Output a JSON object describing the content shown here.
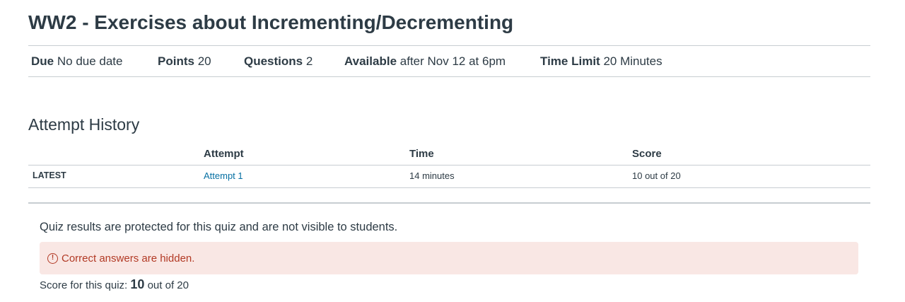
{
  "quiz": {
    "title": "WW2 - Exercises about Incrementing/Decrementing"
  },
  "details": {
    "due_label": "Due",
    "due_value": "No due date",
    "points_label": "Points",
    "points_value": "20",
    "questions_label": "Questions",
    "questions_value": "2",
    "available_label": "Available",
    "available_value": "after Nov 12 at 6pm",
    "time_limit_label": "Time Limit",
    "time_limit_value": "20 Minutes"
  },
  "history": {
    "title": "Attempt History",
    "columns": [
      "Attempt",
      "Time",
      "Score"
    ],
    "rows": [
      {
        "badge": "LATEST",
        "attempt": "Attempt 1",
        "time": "14 minutes",
        "score": "10 out of 20"
      }
    ]
  },
  "results": {
    "protected_message": "Quiz results are protected for this quiz and are not visible to students.",
    "alert_icon": "!",
    "alert_text": "Correct answers are hidden.",
    "score_prefix": "Score for this quiz:",
    "score_value": "10",
    "score_suffix": "out of 20"
  },
  "colors": {
    "link": "#0770a3",
    "alert_bg": "#f9e7e4",
    "alert_text": "#b23a25",
    "text": "#2d3b45"
  }
}
